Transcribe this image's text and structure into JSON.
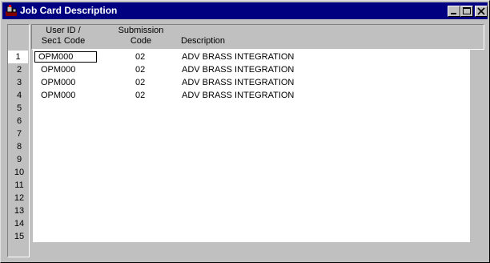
{
  "window": {
    "title": "Job Card Description"
  },
  "columns": [
    {
      "line1": "User ID /",
      "line2": "Sec1 Code"
    },
    {
      "line1": "Submission",
      "line2": "Code"
    },
    {
      "line1": "",
      "line2": "Description"
    }
  ],
  "row_numbers": [
    "1",
    "2",
    "3",
    "4",
    "5",
    "6",
    "7",
    "8",
    "9",
    "10",
    "11",
    "12",
    "13",
    "14",
    "15"
  ],
  "rows": [
    {
      "user_id": "OPM000",
      "code": "02",
      "description": "ADV BRASS INTEGRATION"
    },
    {
      "user_id": "OPM000",
      "code": "02",
      "description": "ADV BRASS INTEGRATION"
    },
    {
      "user_id": "OPM000",
      "code": "02",
      "description": "ADV BRASS INTEGRATION"
    },
    {
      "user_id": "OPM000",
      "code": "02",
      "description": "ADV BRASS INTEGRATION"
    }
  ],
  "icons": {
    "app": "app-icon",
    "minimize": "minimize-icon",
    "maximize": "maximize-icon",
    "close": "close-icon"
  },
  "colors": {
    "titlebar": "#000080",
    "face": "#c0c0c0",
    "grid": "#ffffff"
  }
}
